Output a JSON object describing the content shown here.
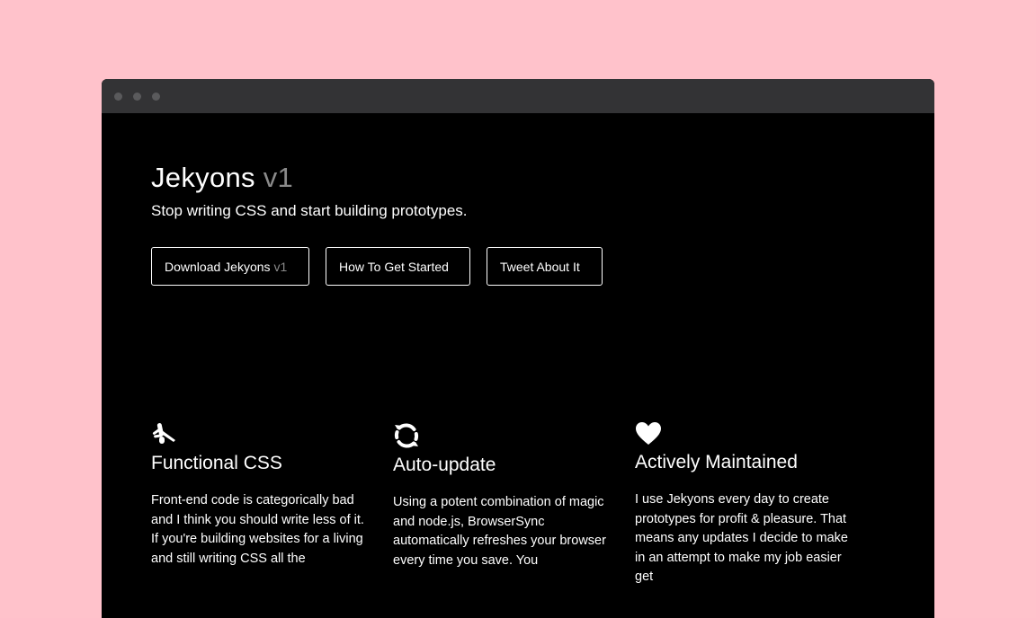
{
  "window": {
    "controls": [
      "close",
      "minimize",
      "maximize"
    ]
  },
  "hero": {
    "title": "Jekyons",
    "version": "v1",
    "subtitle": "Stop writing CSS and start building prototypes."
  },
  "buttons": {
    "download": {
      "label": "Download Jekyons",
      "version": "v1"
    },
    "get_started": {
      "label": "How To Get Started"
    },
    "tweet": {
      "label": "Tweet About It"
    }
  },
  "features": [
    {
      "icon": "swiss-army-knife-icon",
      "title": "Functional CSS",
      "text": "Front-end code is categorically bad and I think you should write less of it. If you're building websites for a living and still writing CSS all the"
    },
    {
      "icon": "refresh-icon",
      "title": "Auto-update",
      "text": "Using a potent combination of magic and node.js, BrowserSync automatically refreshes your browser every time you save. You"
    },
    {
      "icon": "heart-icon",
      "title": "Actively Maintained",
      "text": "I use Jekyons every day to create prototypes for profit & pleasure. That means any updates I decide to make in an attempt to make my job easier get"
    }
  ],
  "colors": {
    "page_background": "#ffc2cb",
    "window_background": "#000000",
    "titlebar": "#333335",
    "muted_version": "#8a8a8a"
  }
}
